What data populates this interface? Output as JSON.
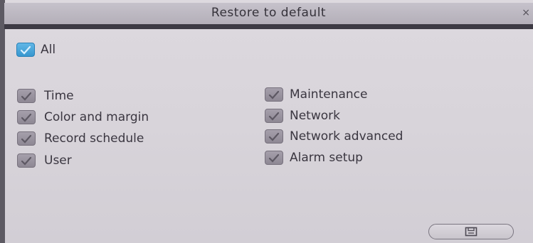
{
  "dialog": {
    "title": "Restore to default",
    "close_glyph": "×"
  },
  "all_option": {
    "label": "All",
    "checked": true
  },
  "left_options": [
    {
      "label": "Time",
      "checked": true
    },
    {
      "label": "Color and margin",
      "checked": true
    },
    {
      "label": "Record schedule",
      "checked": true
    },
    {
      "label": "User",
      "checked": true
    }
  ],
  "right_options": [
    {
      "label": "Maintenance",
      "checked": true
    },
    {
      "label": "Network",
      "checked": true
    },
    {
      "label": "Network advanced",
      "checked": true
    },
    {
      "label": "Alarm setup",
      "checked": true
    }
  ],
  "buttons": {
    "save_icon": "save-icon"
  },
  "colors": {
    "accent_checked": "#3797cf",
    "checkbox_gray": "#8e8894",
    "title_bar": "#b4afb9",
    "divider": "#3d3a44"
  }
}
